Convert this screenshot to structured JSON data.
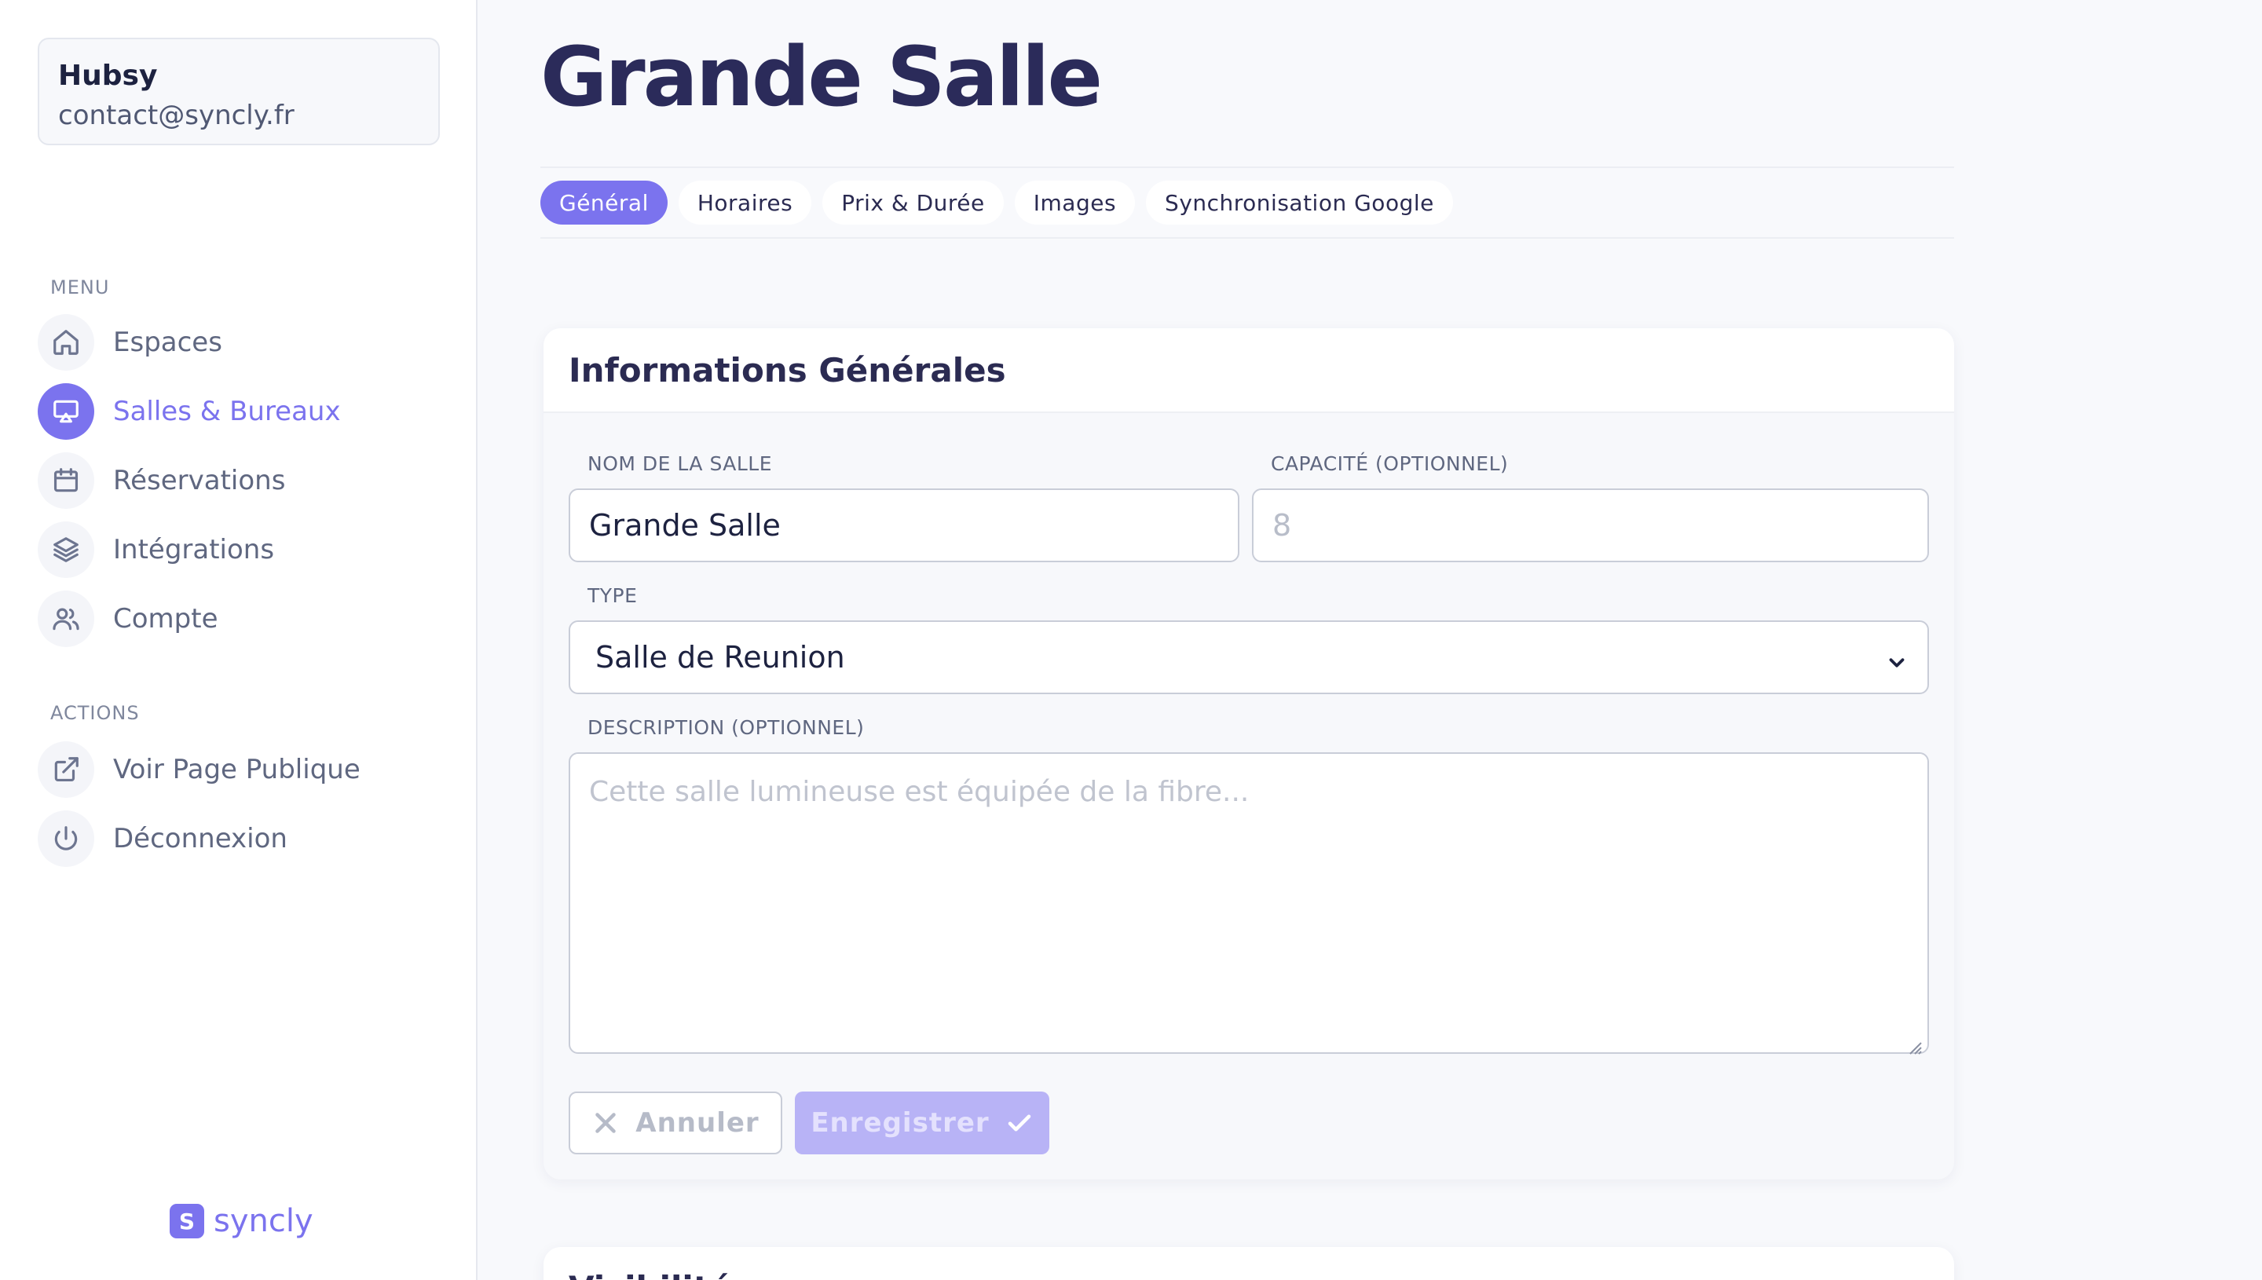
{
  "user": {
    "name": "Hubsy",
    "email": "contact@syncly.fr"
  },
  "sidebar": {
    "menu_label": "MENU",
    "menu_items": [
      {
        "label": "Espaces",
        "icon": "home-icon"
      },
      {
        "label": "Salles & Bureaux",
        "icon": "presentation-icon",
        "active": true
      },
      {
        "label": "Réservations",
        "icon": "calendar-icon"
      },
      {
        "label": "Intégrations",
        "icon": "layers-icon"
      },
      {
        "label": "Compte",
        "icon": "users-icon"
      }
    ],
    "actions_label": "ACTIONS",
    "action_items": [
      {
        "label": "Voir Page Publique",
        "icon": "external-link-icon"
      },
      {
        "label": "Déconnexion",
        "icon": "power-icon"
      }
    ],
    "brand": {
      "logo_letter": "S",
      "name": "syncly"
    }
  },
  "page": {
    "title": "Grande Salle"
  },
  "tabs": [
    {
      "label": "Général",
      "active": true
    },
    {
      "label": "Horaires"
    },
    {
      "label": "Prix & Durée"
    },
    {
      "label": "Images"
    },
    {
      "label": "Synchronisation Google"
    }
  ],
  "form": {
    "section_title": "Informations Générales",
    "name_label": "NOM DE LA SALLE",
    "name_value": "Grande Salle",
    "capacity_label": "CAPACITÉ (OPTIONNEL)",
    "capacity_placeholder": "8",
    "type_label": "TYPE",
    "type_value": "Salle de Reunion",
    "description_label": "DESCRIPTION (OPTIONNEL)",
    "description_placeholder": "Cette salle lumineuse est équipée de la fibre...",
    "cancel_label": "Annuler",
    "save_label": "Enregistrer"
  },
  "next_section": {
    "title": "Visibilité"
  },
  "colors": {
    "accent": "#7b73ee",
    "accent_disabled": "#b8b3f6",
    "title": "#2b2b5a"
  }
}
